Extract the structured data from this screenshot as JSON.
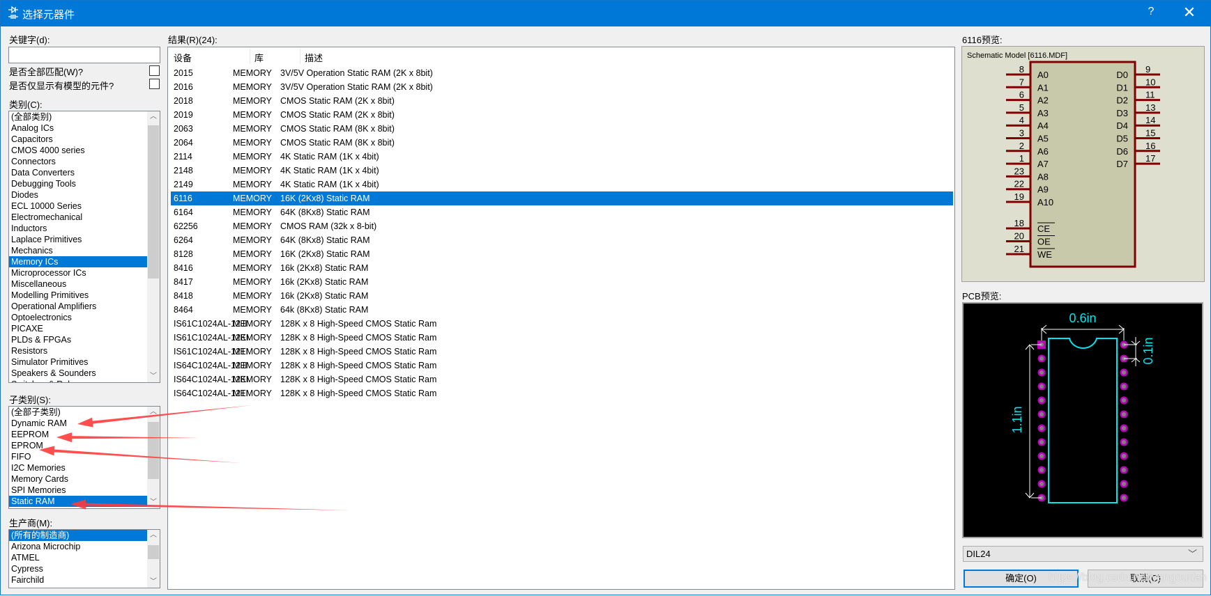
{
  "window": {
    "title": "选择元器件",
    "help": "?",
    "close": "✕",
    "icon": "component-icon"
  },
  "keyword": {
    "label": "关键字(d):",
    "value": "",
    "placeholder": ""
  },
  "options": [
    {
      "label": "是否全部匹配(W)?",
      "checked": false
    },
    {
      "label": "是否仅显示有模型的元件?",
      "checked": false
    }
  ],
  "category": {
    "label": "类别(C):",
    "selected": "Memory ICs",
    "items": [
      "(全部类别)",
      "Analog ICs",
      "Capacitors",
      "CMOS 4000 series",
      "Connectors",
      "Data Converters",
      "Debugging Tools",
      "Diodes",
      "ECL 10000 Series",
      "Electromechanical",
      "Inductors",
      "Laplace Primitives",
      "Mechanics",
      "Memory ICs",
      "Microprocessor ICs",
      "Miscellaneous",
      "Modelling Primitives",
      "Operational Amplifiers",
      "Optoelectronics",
      "PICAXE",
      "PLDs & FPGAs",
      "Resistors",
      "Simulator Primitives",
      "Speakers & Sounders",
      "Switches & Relays"
    ]
  },
  "subcategory": {
    "label": "子类别(S):",
    "selected": "Static RAM",
    "items": [
      "(全部子类别)",
      "Dynamic RAM",
      "EEPROM",
      "EPROM",
      "FIFO",
      "I2C Memories",
      "Memory Cards",
      "SPI Memories",
      "Static RAM"
    ]
  },
  "manufacturer": {
    "label": "生产商(M):",
    "selected": "(所有的制造商)",
    "items": [
      "(所有的制造商)",
      "Arizona Microchip",
      "ATMEL",
      "Cypress",
      "Fairchild"
    ]
  },
  "results": {
    "label": "结果(R)(24):",
    "columns": [
      "设备",
      "库",
      "描述"
    ],
    "selected": "6116",
    "rows": [
      [
        "2015",
        "MEMORY",
        "3V/5V Operation Static RAM (2K x 8bit)"
      ],
      [
        "2016",
        "MEMORY",
        "3V/5V Operation Static RAM (2K x 8bit)"
      ],
      [
        "2018",
        "MEMORY",
        "CMOS Static RAM (2K x 8bit)"
      ],
      [
        "2019",
        "MEMORY",
        "CMOS Static RAM (2K x 8bit)"
      ],
      [
        "2063",
        "MEMORY",
        "CMOS Static RAM (8K x 8bit)"
      ],
      [
        "2064",
        "MEMORY",
        "CMOS Static RAM (8K x 8bit)"
      ],
      [
        "2114",
        "MEMORY",
        "4K Static RAM (1K x 4bit)"
      ],
      [
        "2148",
        "MEMORY",
        "4K Static RAM (1K x 4bit)"
      ],
      [
        "2149",
        "MEMORY",
        "4K Static RAM (1K x 4bit)"
      ],
      [
        "6116",
        "MEMORY",
        "16K (2Kx8) Static RAM"
      ],
      [
        "6164",
        "MEMORY",
        "64K (8Kx8) Static RAM"
      ],
      [
        "62256",
        "MEMORY",
        "CMOS RAM (32k x 8-bit)"
      ],
      [
        "6264",
        "MEMORY",
        "64K (8Kx8) Static RAM"
      ],
      [
        "8128",
        "MEMORY",
        "16K (2Kx8) Static RAM"
      ],
      [
        "8416",
        "MEMORY",
        "16k (2Kx8) Static RAM"
      ],
      [
        "8417",
        "MEMORY",
        "16k (2Kx8) Static RAM"
      ],
      [
        "8418",
        "MEMORY",
        "16k (2Kx8) Static RAM"
      ],
      [
        "8464",
        "MEMORY",
        "64k (8Kx8) Static RAM"
      ],
      [
        "IS61C1024AL-12JI",
        "MEMORY",
        "128K x 8 High-Speed CMOS Static Ram"
      ],
      [
        "IS61C1024AL-12KI",
        "MEMORY",
        "128K x 8 High-Speed CMOS Static Ram"
      ],
      [
        "IS61C1024AL-12TI",
        "MEMORY",
        "128K x 8 High-Speed CMOS Static Ram"
      ],
      [
        "IS64C1024AL-12JI",
        "MEMORY",
        "128K x 8 High-Speed CMOS Static Ram"
      ],
      [
        "IS64C1024AL-12KI",
        "MEMORY",
        "128K x 8 High-Speed CMOS Static Ram"
      ],
      [
        "IS64C1024AL-12TI",
        "MEMORY",
        "128K x 8 High-Speed CMOS Static Ram"
      ]
    ]
  },
  "preview": {
    "label": "6116预览:",
    "model": "Schematic Model [6116.MDF]",
    "left_pins": [
      [
        "8",
        "A0"
      ],
      [
        "7",
        "A1"
      ],
      [
        "6",
        "A2"
      ],
      [
        "5",
        "A3"
      ],
      [
        "4",
        "A4"
      ],
      [
        "3",
        "A5"
      ],
      [
        "2",
        "A6"
      ],
      [
        "1",
        "A7"
      ],
      [
        "23",
        "A8"
      ],
      [
        "22",
        "A9"
      ],
      [
        "19",
        "A10"
      ]
    ],
    "ctrl_pins": [
      [
        "18",
        "CE"
      ],
      [
        "20",
        "OE"
      ],
      [
        "21",
        "WE"
      ]
    ],
    "right_pins": [
      [
        "9",
        "D0"
      ],
      [
        "10",
        "D1"
      ],
      [
        "11",
        "D2"
      ],
      [
        "13",
        "D3"
      ],
      [
        "14",
        "D4"
      ],
      [
        "15",
        "D5"
      ],
      [
        "16",
        "D6"
      ],
      [
        "17",
        "D7"
      ]
    ],
    "colors": {
      "body": "#c8c8aa",
      "bg": "#dfdfcf",
      "pin": "#800000"
    }
  },
  "pcb": {
    "label": "PCB预览:",
    "width_dim": "0.6in",
    "height_dim": "1.1in",
    "pitch_dim": "0.1in",
    "pads_per_side": 12,
    "colors": {
      "bg": "#000000",
      "outline": "#00e5ee",
      "pad": "#c000c0",
      "drill": "#808080",
      "dim": "#ffffff"
    }
  },
  "package": {
    "value": "DIL24"
  },
  "buttons": {
    "ok": "确定(O)",
    "cancel": "取消(C)"
  },
  "watermark": "https://blog.csdn.net/yangoudan",
  "annotation_color": "#ff3b3b"
}
